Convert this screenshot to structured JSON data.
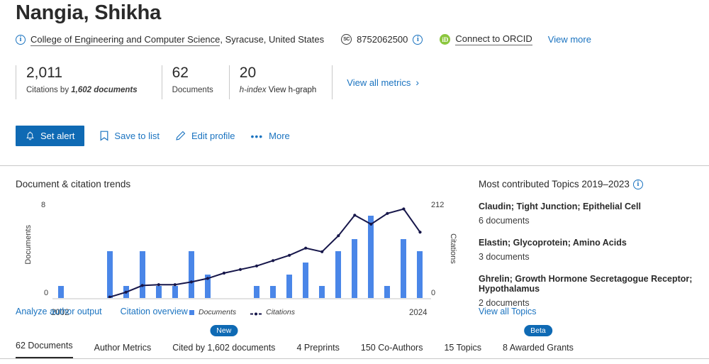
{
  "header": {
    "author_name": "Nangia, Shikha",
    "info_icon": "info-circle-icon",
    "affiliation_link": "College of Engineering and Computer Science",
    "affiliation_rest": ", Syracuse, United States",
    "scopus_icon": "scopus-id-icon",
    "scopus_author_id": "8752062500",
    "scopus_info_icon": "info-circle-icon",
    "orcid_icon": "orcid-icon",
    "orcid_link": "Connect to ORCID",
    "view_more": "View more"
  },
  "metrics": {
    "items": [
      {
        "value": "2,011",
        "label_prefix": "Citations by ",
        "label_bold": "1,602 documents",
        "label_suffix": ""
      },
      {
        "value": "62",
        "label_prefix": "Documents",
        "label_bold": "",
        "label_suffix": ""
      },
      {
        "value": "20",
        "label_prefix": "h-index ",
        "label_bold": "",
        "label_suffix": "View h-graph"
      }
    ],
    "view_all_metrics": "View all metrics",
    "chevron_icon": "chevron-right-icon"
  },
  "actions": {
    "set_alert": "Set alert",
    "set_alert_icon": "bell-icon",
    "save_to_list": "Save to list",
    "save_to_list_icon": "bookmark-icon",
    "edit_profile": "Edit profile",
    "edit_profile_icon": "pencil-icon",
    "more": "More",
    "more_icon": "ellipsis-icon"
  },
  "trends_panel": {
    "title": "Document & citation trends",
    "links": [
      {
        "label": "Analyze author output"
      },
      {
        "label": "Citation overview"
      }
    ]
  },
  "topics_panel": {
    "title": "Most contributed Topics 2019–2023",
    "info_icon": "info-circle-icon",
    "topics": [
      {
        "name": "Claudin; Tight Junction; Epithelial Cell",
        "count": "6 documents"
      },
      {
        "name": "Elastin; Glycoprotein; Amino Acids",
        "count": "3 documents"
      },
      {
        "name": "Ghrelin; Growth Hormone Secretagogue Receptor; Hypothalamus",
        "count": "2 documents"
      }
    ],
    "view_all": "View all Topics"
  },
  "tabs": [
    {
      "label": "62 Documents",
      "active": true,
      "badge": ""
    },
    {
      "label": "Author Metrics",
      "active": false,
      "badge": ""
    },
    {
      "label": "Cited by 1,602 documents",
      "active": false,
      "badge": "New"
    },
    {
      "label": "4 Preprints",
      "active": false,
      "badge": ""
    },
    {
      "label": "150 Co-Authors",
      "active": false,
      "badge": ""
    },
    {
      "label": "15 Topics",
      "active": false,
      "badge": ""
    },
    {
      "label": "8 Awarded Grants",
      "active": false,
      "badge": "Beta"
    }
  ],
  "colors": {
    "accent_blue": "#0f6ab4",
    "link_blue": "#1a73c0",
    "bar_blue": "#4a86e8",
    "line_navy": "#16164a",
    "orcid_green": "#8bc63e"
  },
  "chart_data": {
    "type": "bar",
    "title": "Document & citation trends",
    "xlabel": "",
    "ylabel": "Documents",
    "y2label": "Citations",
    "grid": false,
    "legend_position": "bottom-center",
    "x_tick_labels": [
      "2002",
      "2024"
    ],
    "ylim": [
      0,
      8
    ],
    "y2lim": [
      0,
      212
    ],
    "y_ticks": [
      0,
      8
    ],
    "y2_ticks": [
      0,
      212
    ],
    "categories": [
      2002,
      2003,
      2004,
      2005,
      2006,
      2007,
      2008,
      2009,
      2010,
      2011,
      2012,
      2013,
      2014,
      2015,
      2016,
      2017,
      2018,
      2019,
      2020,
      2021,
      2022,
      2023,
      2024
    ],
    "series": [
      {
        "name": "Documents",
        "type": "bar",
        "axis": "left",
        "values": [
          1,
          0,
          0,
          4,
          1,
          4,
          1,
          1,
          4,
          2,
          0,
          0,
          1,
          1,
          2,
          3,
          1,
          4,
          5,
          7,
          1,
          5,
          4
        ]
      },
      {
        "name": "Citations",
        "type": "line",
        "axis": "right",
        "values": [
          null,
          null,
          null,
          2,
          13,
          28,
          30,
          30,
          36,
          44,
          56,
          64,
          72,
          84,
          96,
          112,
          104,
          140,
          186,
          166,
          190,
          200,
          148
        ]
      }
    ]
  }
}
